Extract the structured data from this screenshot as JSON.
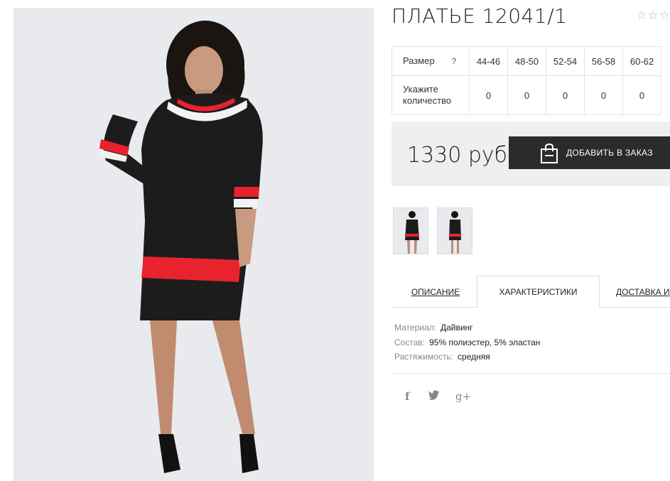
{
  "product": {
    "title": "ПЛАТЬЕ 12041/1",
    "rating_stars": "☆☆☆"
  },
  "size_table": {
    "size_label": "Размер",
    "help_mark": "?",
    "qty_label": "Укажите количество",
    "sizes": [
      "44-46",
      "48-50",
      "52-54",
      "56-58",
      "60-62"
    ],
    "quantities": [
      "0",
      "0",
      "0",
      "0",
      "0"
    ]
  },
  "price": {
    "amount": "1330 руб",
    "order_button": "ДОБАВИТЬ В ЗАКАЗ"
  },
  "tabs": [
    {
      "label": "ОПИСАНИЕ",
      "active": false
    },
    {
      "label": "ХАРАКТЕРИСТИКИ",
      "active": true
    },
    {
      "label": "ДОСТАВКА И",
      "active": false
    }
  ],
  "specs": [
    {
      "key": "Материал:",
      "value": "Дайвинг"
    },
    {
      "key": "Состав:",
      "value": "95% полиэстер, 5% эластан"
    },
    {
      "key": "Растяжимость:",
      "value": "средняя"
    }
  ],
  "social": {
    "facebook": "f",
    "twitter": "🐦",
    "gplus": "g+"
  },
  "colors": {
    "dress": "#1c1c1c",
    "stripe_red": "#e8232e",
    "stripe_white": "#f2f2f2",
    "button_dark": "#2b2b2b",
    "price_bg": "#efefef"
  }
}
